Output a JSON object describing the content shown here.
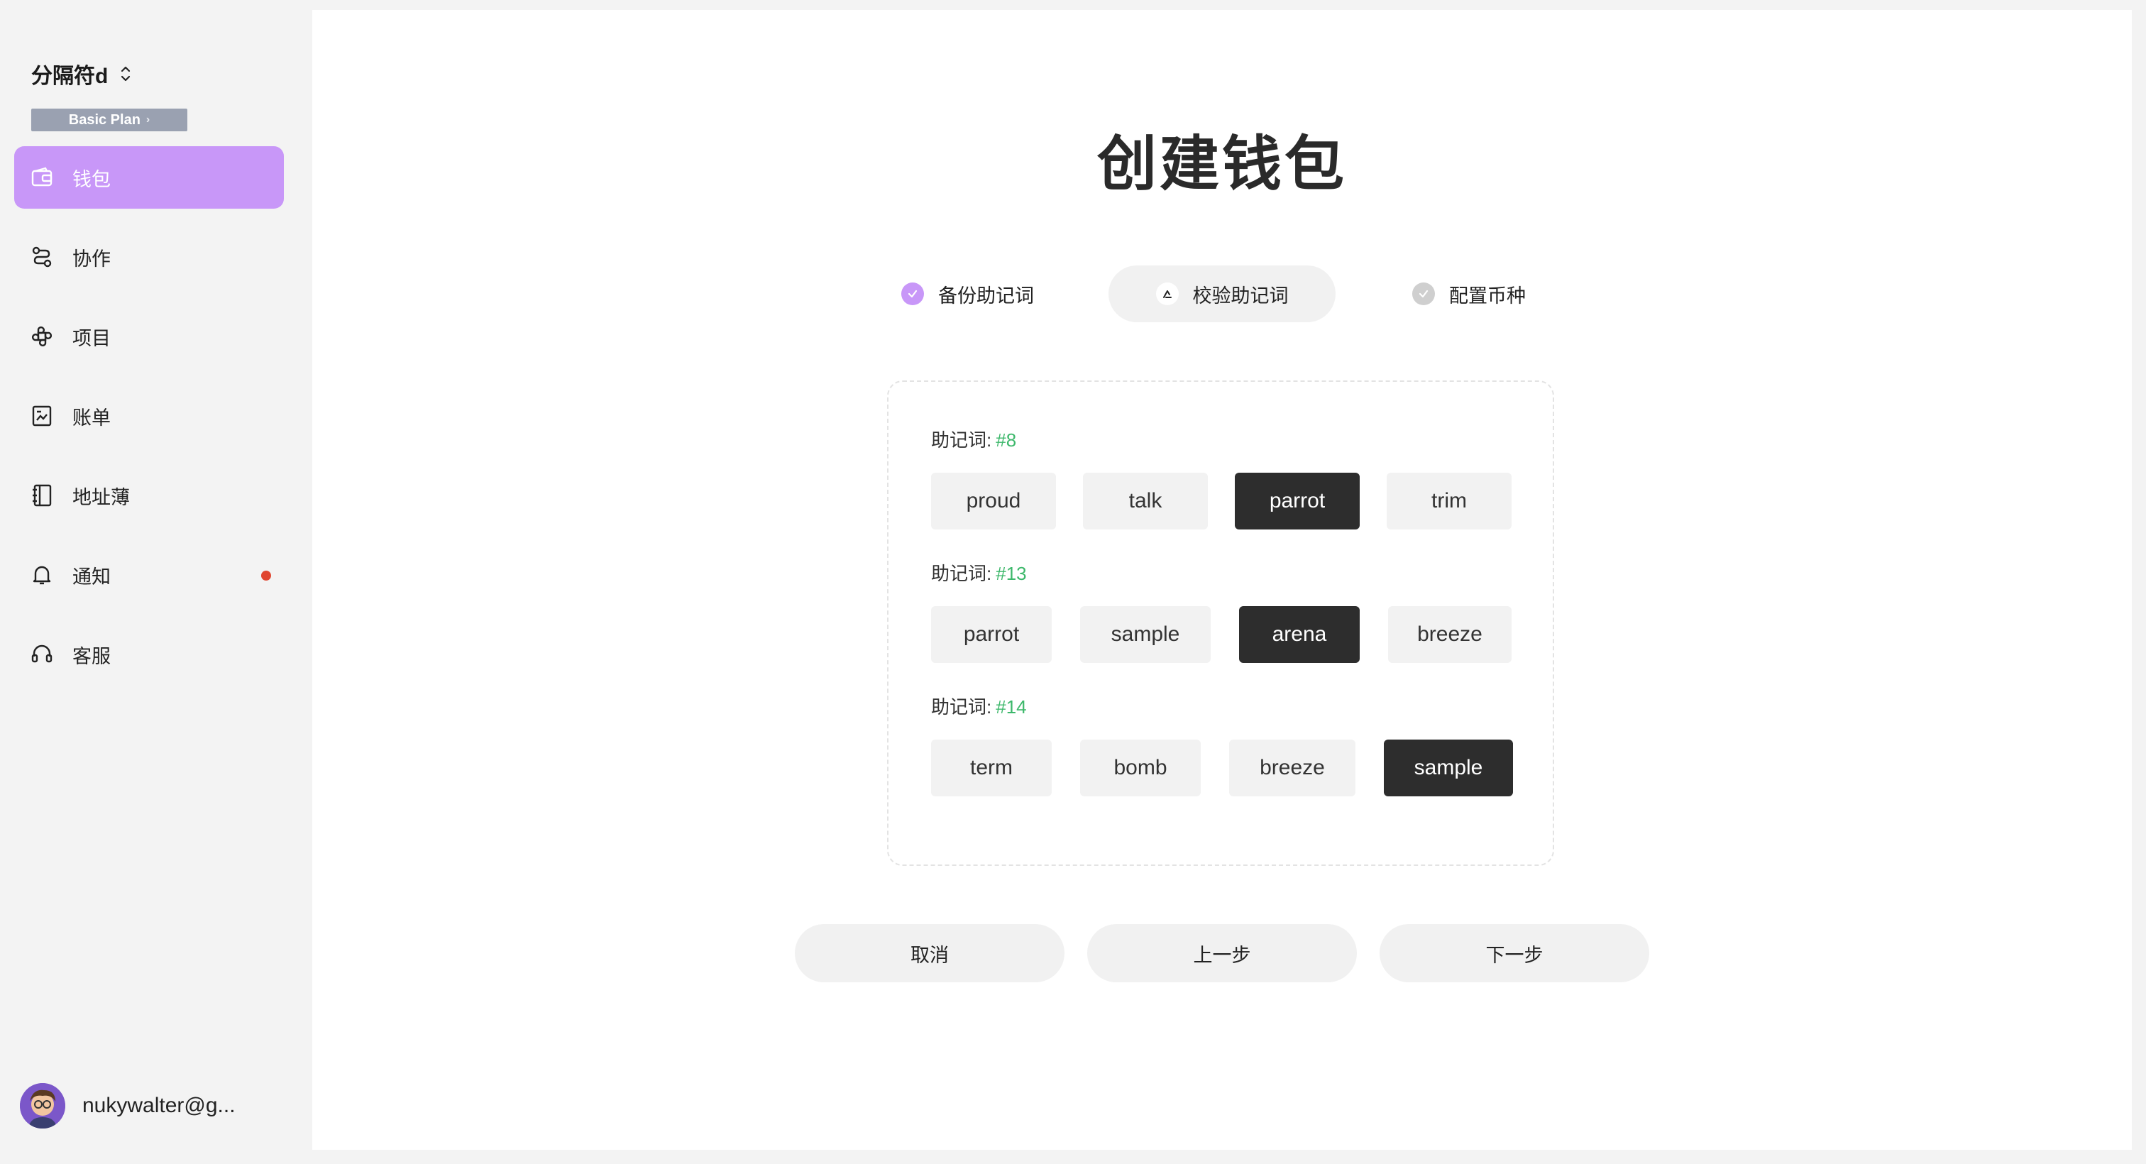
{
  "sidebar": {
    "workspace_name": "分隔符d",
    "plan_label": "Basic Plan",
    "plan_chevron": "›",
    "items": [
      {
        "label": "钱包",
        "icon": "wallet-icon",
        "active": true
      },
      {
        "label": "协作",
        "icon": "collaboration-icon"
      },
      {
        "label": "项目",
        "icon": "project-icon"
      },
      {
        "label": "账单",
        "icon": "bill-icon"
      },
      {
        "label": "地址薄",
        "icon": "address-book-icon"
      },
      {
        "label": "通知",
        "icon": "bell-icon",
        "badge_color": "#e0452f"
      },
      {
        "label": "客服",
        "icon": "headset-icon"
      }
    ],
    "user_email": "nukywalter@g..."
  },
  "main": {
    "title": "创建钱包",
    "steps": [
      {
        "label": "备份助记词",
        "state": "done"
      },
      {
        "label": "校验助记词",
        "state": "current"
      },
      {
        "label": "配置币种",
        "state": "pending"
      }
    ],
    "groups": [
      {
        "prefix": "助记词:",
        "number": "#8",
        "words": [
          "proud",
          "talk",
          "parrot",
          "trim"
        ],
        "selected": 2
      },
      {
        "prefix": "助记词:",
        "number": "#13",
        "words": [
          "parrot",
          "sample",
          "arena",
          "breeze"
        ],
        "selected": 2
      },
      {
        "prefix": "助记词:",
        "number": "#14",
        "words": [
          "term",
          "bomb",
          "breeze",
          "sample"
        ],
        "selected": 3
      }
    ],
    "buttons": {
      "cancel": "取消",
      "prev": "上一步",
      "next": "下一步"
    }
  },
  "colors": {
    "accent": "#c897f8",
    "selected_word_bg": "#2d2d2d",
    "number_green": "#3db86b",
    "notification_dot": "#e0452f"
  }
}
